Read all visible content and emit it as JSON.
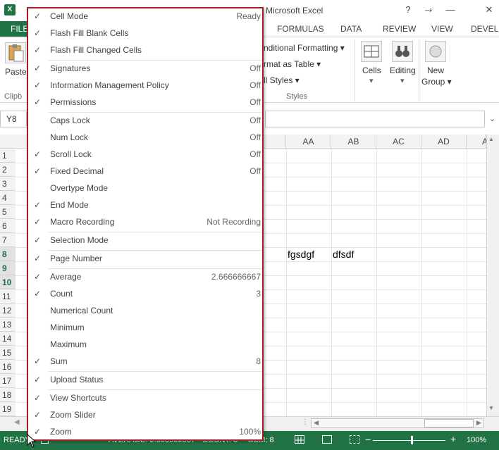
{
  "window": {
    "app_logo": "X",
    "title": "Microsoft Excel",
    "help": "?",
    "ribbon_options": "⤑",
    "minimize": "—",
    "close": "✕"
  },
  "ribbon_tabs": {
    "file": "FILE",
    "formulas": "FORMULAS",
    "data": "DATA",
    "review": "REVIEW",
    "view": "VIEW",
    "developer": "DEVEL"
  },
  "ribbon": {
    "paste_label": "Paste",
    "clipboard_group": "Clipb",
    "conditional_formatting": "nditional Formatting ▾",
    "format_as_table": "rmat as Table ▾",
    "cell_styles": "ll Styles ▾",
    "styles_group": "Styles",
    "cells_label": "Cells",
    "editing_label": "Editing",
    "new_group_line1": "New",
    "new_group_line2": "Group ▾"
  },
  "formula_bar": {
    "name_box": "Y8"
  },
  "columns": [
    "AA",
    "AB",
    "AC",
    "AD"
  ],
  "partial_column": "A",
  "rows": [
    "1",
    "2",
    "3",
    "4",
    "5",
    "6",
    "7",
    "8",
    "9",
    "10",
    "11",
    "12",
    "13",
    "14",
    "15",
    "16",
    "17",
    "18",
    "19"
  ],
  "cells": {
    "AA8": "fgsdgf",
    "AB8": "dfsdf"
  },
  "status_bar": {
    "ready": "READY",
    "average": "AVERAGE: 2.666666667",
    "count": "COUNT: 3",
    "sum": "SUM: 8",
    "zoom": "100%",
    "zoom_minus": "−",
    "zoom_plus": "+"
  },
  "menu": {
    "check_glyph": "✓",
    "items": [
      {
        "label": "Cell Mode",
        "value": "Ready",
        "checked": true
      },
      {
        "label": "Flash Fill Blank Cells",
        "value": "",
        "checked": true
      },
      {
        "label": "Flash Fill Changed Cells",
        "value": "",
        "checked": true
      },
      {
        "label": "Signatures",
        "value": "Off",
        "checked": true
      },
      {
        "label": "Information Management Policy",
        "value": "Off",
        "checked": true
      },
      {
        "label": "Permissions",
        "value": "Off",
        "checked": true
      },
      {
        "label": "Caps Lock",
        "value": "Off",
        "checked": false
      },
      {
        "label": "Num Lock",
        "value": "Off",
        "checked": false
      },
      {
        "label": "Scroll Lock",
        "value": "Off",
        "checked": true
      },
      {
        "label": "Fixed Decimal",
        "value": "Off",
        "checked": true
      },
      {
        "label": "Overtype Mode",
        "value": "",
        "checked": false
      },
      {
        "label": "End Mode",
        "value": "",
        "checked": true
      },
      {
        "label": "Macro Recording",
        "value": "Not Recording",
        "checked": true
      },
      {
        "label": "Selection Mode",
        "value": "",
        "checked": true
      },
      {
        "label": "Page Number",
        "value": "",
        "checked": true
      },
      {
        "label": "Average",
        "value": "2.666666667",
        "checked": true
      },
      {
        "label": "Count",
        "value": "3",
        "checked": true
      },
      {
        "label": "Numerical Count",
        "value": "",
        "checked": false
      },
      {
        "label": "Minimum",
        "value": "",
        "checked": false
      },
      {
        "label": "Maximum",
        "value": "",
        "checked": false
      },
      {
        "label": "Sum",
        "value": "8",
        "checked": true
      },
      {
        "label": "Upload Status",
        "value": "",
        "checked": true
      },
      {
        "label": "View Shortcuts",
        "value": "",
        "checked": true
      },
      {
        "label": "Zoom Slider",
        "value": "",
        "checked": true
      },
      {
        "label": "Zoom",
        "value": "100%",
        "checked": true
      }
    ]
  }
}
